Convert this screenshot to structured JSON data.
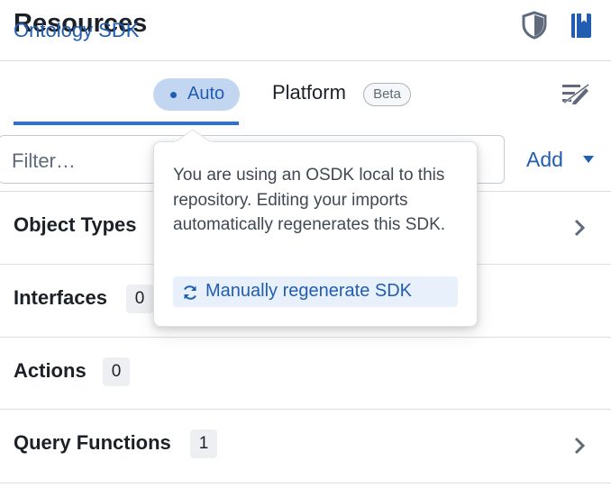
{
  "header": {
    "title": "Resources",
    "icons": [
      "shield-icon",
      "book-icon"
    ]
  },
  "tabs": {
    "osdk_label": "Ontology SDK",
    "osdk_badge": "Auto",
    "platform_label": "Platform",
    "platform_badge": "Beta",
    "right_icon": "edit-lines-icon"
  },
  "filter": {
    "placeholder": "Filter…",
    "value": ""
  },
  "add_button": {
    "label": "Add"
  },
  "rows": [
    {
      "name": "Object Types",
      "count": "",
      "chevron": true
    },
    {
      "name": "Interfaces",
      "count": "0",
      "chevron": false
    },
    {
      "name": "Actions",
      "count": "0",
      "chevron": false
    },
    {
      "name": "Query Functions",
      "count": "1",
      "chevron": true
    }
  ],
  "popover": {
    "message": "You are using an OSDK local to this repository. Editing your imports automatically regenerates this SDK.",
    "button_label": "Manually regenerate SDK"
  },
  "colors": {
    "accent": "#215db0",
    "tab_underline": "#2d72d2",
    "auto_pill_bg": "#c2d6f1",
    "text": "#1c2127",
    "divider": "#dcdfe3"
  }
}
